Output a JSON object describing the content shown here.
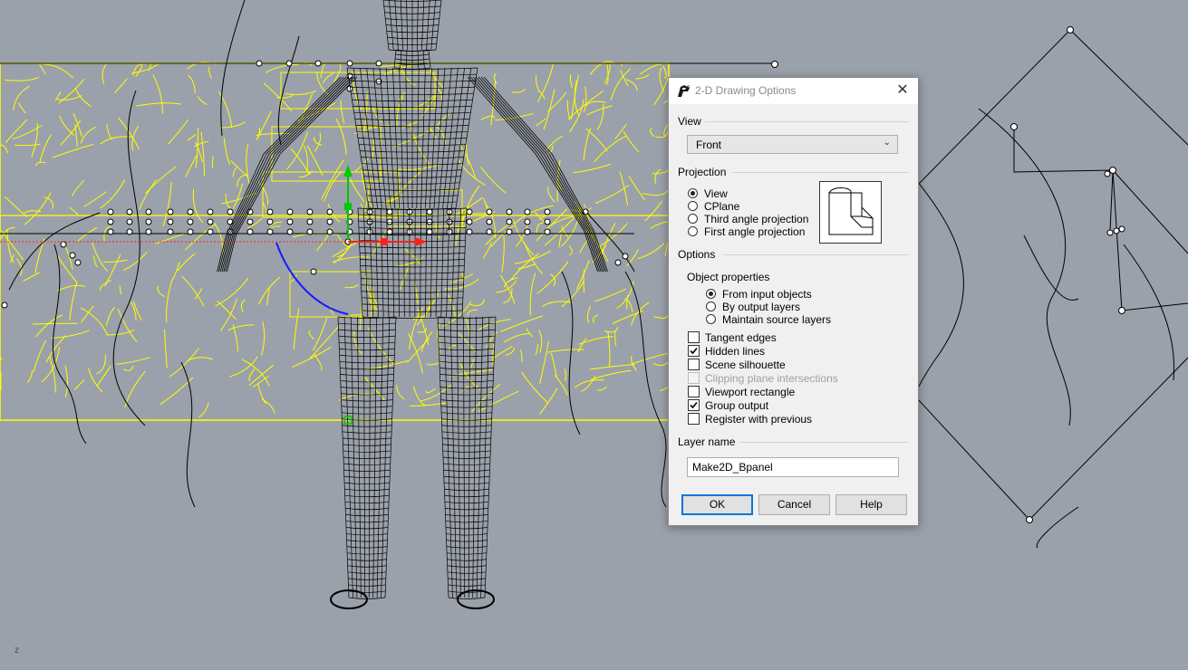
{
  "viewport": {
    "axis_label": "z",
    "colors": {
      "background": "#9ba1aa",
      "selection": "#ffff00",
      "wireframe": "#000000"
    }
  },
  "dialog": {
    "title": "2-D Drawing Options",
    "close_icon": "close-icon",
    "view_section": "View",
    "view_value": "Front",
    "projection_section": "Projection",
    "projection_options": [
      "View",
      "CPlane",
      "Third angle projection",
      "First angle projection"
    ],
    "projection_selected": "View",
    "options_section": "Options",
    "object_properties_label": "Object properties",
    "object_property_options": [
      "From input objects",
      "By output layers",
      "Maintain source layers"
    ],
    "object_property_selected": "From input objects",
    "checkboxes": [
      {
        "label": "Tangent edges",
        "checked": false,
        "enabled": true
      },
      {
        "label": "Hidden lines",
        "checked": true,
        "enabled": true
      },
      {
        "label": "Scene silhouette",
        "checked": false,
        "enabled": true
      },
      {
        "label": "Clipping plane intersections",
        "checked": false,
        "enabled": false
      },
      {
        "label": "Viewport rectangle",
        "checked": false,
        "enabled": true
      },
      {
        "label": "Group output",
        "checked": true,
        "enabled": true
      },
      {
        "label": "Register with previous",
        "checked": false,
        "enabled": true
      }
    ],
    "layer_section": "Layer name",
    "layer_value": "Make2D_Bpanel",
    "buttons": {
      "ok": "OK",
      "cancel": "Cancel",
      "help": "Help"
    }
  }
}
